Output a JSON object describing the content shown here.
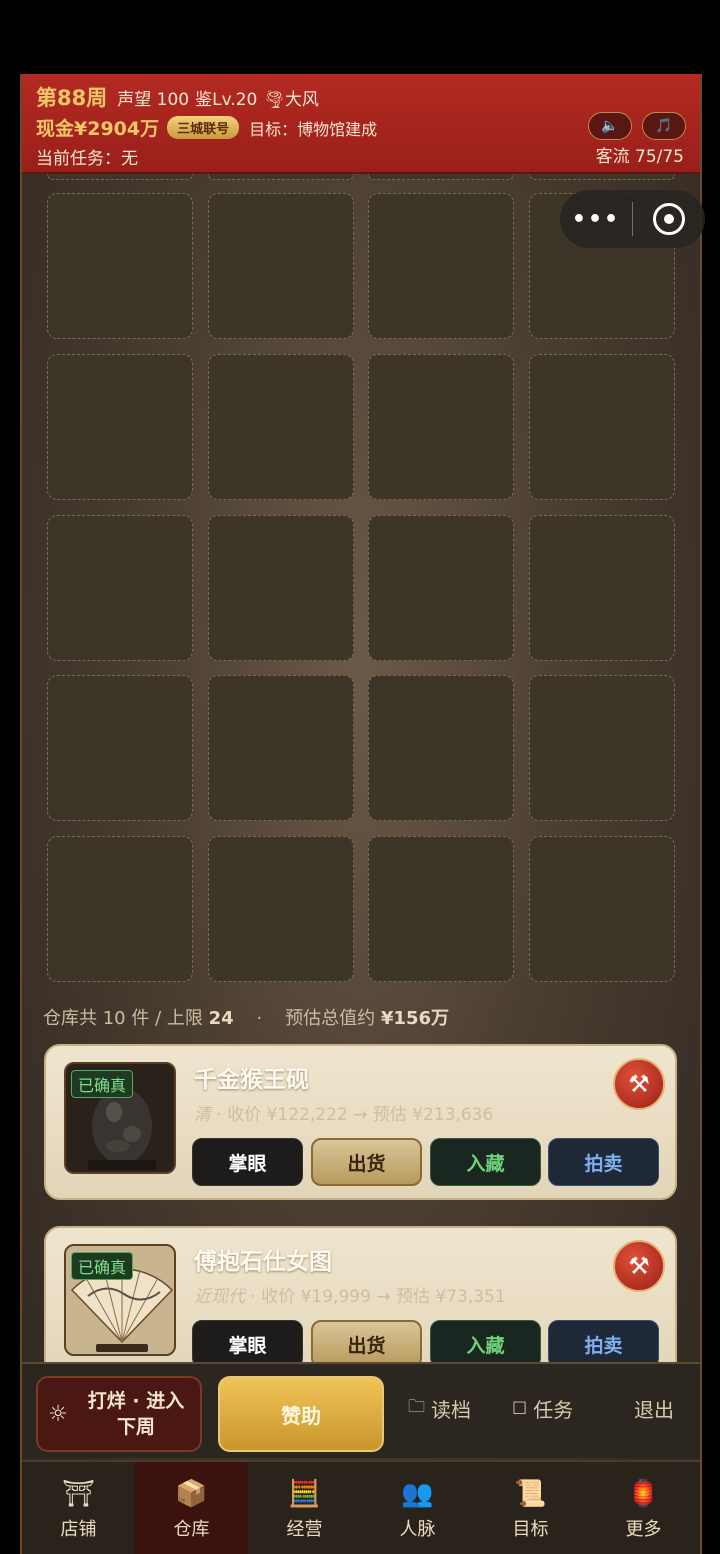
{
  "header": {
    "week": "第88周",
    "reputation": "声望 100",
    "appraisal": "鉴Lv.20",
    "weather": "🌪大风",
    "cash": "现金¥2904万",
    "city_badge": "三城联号",
    "goal": "目标：博物馆建成",
    "task": "当前任务：无",
    "traffic": "客流 75/75",
    "sound_icon": "🔈",
    "music_icon": "🎵"
  },
  "capsule": {
    "more": "•••"
  },
  "warehouse": {
    "summary_prefix": "仓库共 10 件 / 上限 ",
    "capacity": "24",
    "dot": "·",
    "value_prefix": "预估总值约 ",
    "value": "¥156万"
  },
  "items": [
    {
      "verified": "已确真",
      "name": "千金猴王砚",
      "era": "清",
      "meta": " · 收价 ¥122,222 → 预估 ¥213,636",
      "actions": {
        "eye": "掌眼",
        "ship": "出货",
        "keep": "入藏",
        "auction": "拍卖"
      }
    },
    {
      "verified": "已确真",
      "name": "傅抱石仕女图",
      "era": "近现代",
      "meta": " · 收价 ¥19,999 → 预估 ¥73,351",
      "actions": {
        "eye": "掌眼",
        "ship": "出货",
        "keep": "入藏",
        "auction": "拍卖"
      }
    }
  ],
  "action_bar": {
    "next_line1": "打烊 · 进入",
    "next_line2": "下周",
    "sponsor": "赞助",
    "load": "读档",
    "tasks": "任务",
    "exit": "退出"
  },
  "tabs": [
    {
      "label": "店铺",
      "icon": "shop-icon",
      "glyph": "⛩"
    },
    {
      "label": "仓库",
      "icon": "warehouse-icon",
      "glyph": "📦"
    },
    {
      "label": "经营",
      "icon": "abacus-icon",
      "glyph": "🧮"
    },
    {
      "label": "人脉",
      "icon": "people-icon",
      "glyph": "👥"
    },
    {
      "label": "目标",
      "icon": "scroll-icon",
      "glyph": "📜"
    },
    {
      "label": "更多",
      "icon": "more-icon",
      "glyph": "🏮"
    }
  ],
  "active_tab": "仓库"
}
